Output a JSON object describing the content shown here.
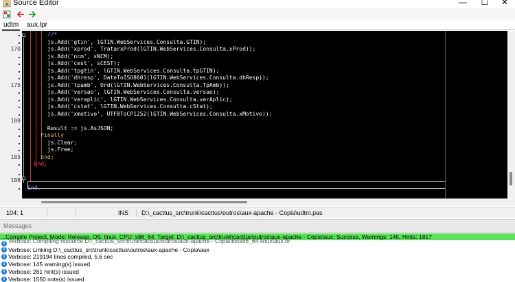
{
  "window": {
    "title": "Source Editor",
    "minimize_glyph": "—",
    "maximize_glyph": "☐",
    "close_glyph": "✕"
  },
  "toolbar": {
    "icons": [
      "program-icon",
      "back-arrow-icon",
      "forward-arrow-icon"
    ]
  },
  "tabs": [
    {
      "label": "udtm",
      "active": true
    },
    {
      "label": "aux.lpr",
      "active": false
    }
  ],
  "editor": {
    "line_numbers": [
      {
        "line": 170,
        "label": "170"
      },
      {
        "line": 175,
        "label": "175"
      },
      {
        "line": 180,
        "label": "180"
      },
      {
        "line": 185,
        "label": "185"
      },
      {
        "line": 188,
        "label": "188"
      }
    ],
    "lines": [
      {
        "text": "      //*",
        "color": "#9aa0ff"
      },
      {
        "text": "      js.Add('gtin', lGTIN.WebServices.Consulta.GTIN);",
        "color": "#ffffff"
      },
      {
        "text": "      js.Add('xprod', TratarxProd(lGTIN.WebServices.Consulta.xProd));",
        "color": "#ffffff"
      },
      {
        "text": "      js.Add('ncm', sNCM);",
        "color": "#ffffff"
      },
      {
        "text": "      js.Add('cest', sCEST);",
        "color": "#ffffff"
      },
      {
        "text": "      js.Add('tpgtin', lGTIN.WebServices.Consulta.tpGTIN);",
        "color": "#ffffff"
      },
      {
        "text": "      js.Add('dhresp', DateToISO8601(lGTIN.WebServices.Consulta.dhResp));",
        "color": "#ffffff"
      },
      {
        "text": "      js.Add('tpamb', Ord(lGTIN.WebServices.Consulta.TpAmb));",
        "color": "#ffffff"
      },
      {
        "text": "      js.Add('versao', lGTIN.WebServices.Consulta.versao);",
        "color": "#ffffff"
      },
      {
        "text": "      js.Add('veraplic', lGTIN.WebServices.Consulta.verAplic);",
        "color": "#ffffff"
      },
      {
        "text": "      js.Add('cstat', lGTIN.WebServices.Consulta.cStat);",
        "color": "#ffffff"
      },
      {
        "text": "      js.Add('xmotivo', UTF8ToCP1252(lGTIN.WebServices.Consulta.xMotivo));",
        "color": "#ffffff"
      },
      {
        "text": "",
        "color": "#ffffff"
      },
      {
        "text": "      Result := js.AsJSON;",
        "color": "#ffffff"
      },
      {
        "text": "    Finally",
        "color": "#e6c84a"
      },
      {
        "text": "      js.Clear;",
        "color": "#ffffff"
      },
      {
        "text": "      js.Free;",
        "color": "#ffffff"
      },
      {
        "text": "    End;",
        "color": "#e6c84a"
      },
      {
        "text": "  End;",
        "color": "#ff4d4d"
      },
      {
        "text": "",
        "color": "#ffffff"
      },
      {
        "text": "",
        "color": "#ffffff"
      },
      {
        "text": "End.",
        "color": "#9aa0ff"
      }
    ]
  },
  "statusbar": {
    "position": "104:  1",
    "mode": "INS",
    "file": "D:\\_cacttus_src\\trunk\\cacttus\\outros\\aux-apache - Copia\\udtm.pas"
  },
  "messages": {
    "header": "Messages",
    "items": [
      {
        "text": "...Compile Project, Mode: Release, OS: linux, CPU: x86_64, Target: D:\\_cacttus_src\\trunk\\cacttus\\outros\\aux-apache - Copia\\aux: Success, Warnings: 145, Hints: 1817",
        "style": "hl",
        "icon": false
      },
      {
        "text": "Verbose: Compiling resource D:\\_cacttus_src\\trunk\\cacttus\\outros\\aux-apache - Copia\\lib\\x86_64-linux\\aux.or",
        "style": "partial",
        "icon": true
      },
      {
        "text": "Verbose: Linking D:\\_cacttus_src\\trunk\\cacttus\\outros\\aux-apache - Copia\\aux",
        "style": "",
        "icon": true
      },
      {
        "text": "Verbose: 219194 lines compiled, 5.6 sec",
        "style": "",
        "icon": true
      },
      {
        "text": "Verbose: 145 warning(s) issued",
        "style": "",
        "icon": true
      },
      {
        "text": "Verbose: 281 hint(s) issued",
        "style": "",
        "icon": true
      },
      {
        "text": "Verbose: 1550 note(s) issued",
        "style": "",
        "icon": true
      }
    ]
  }
}
